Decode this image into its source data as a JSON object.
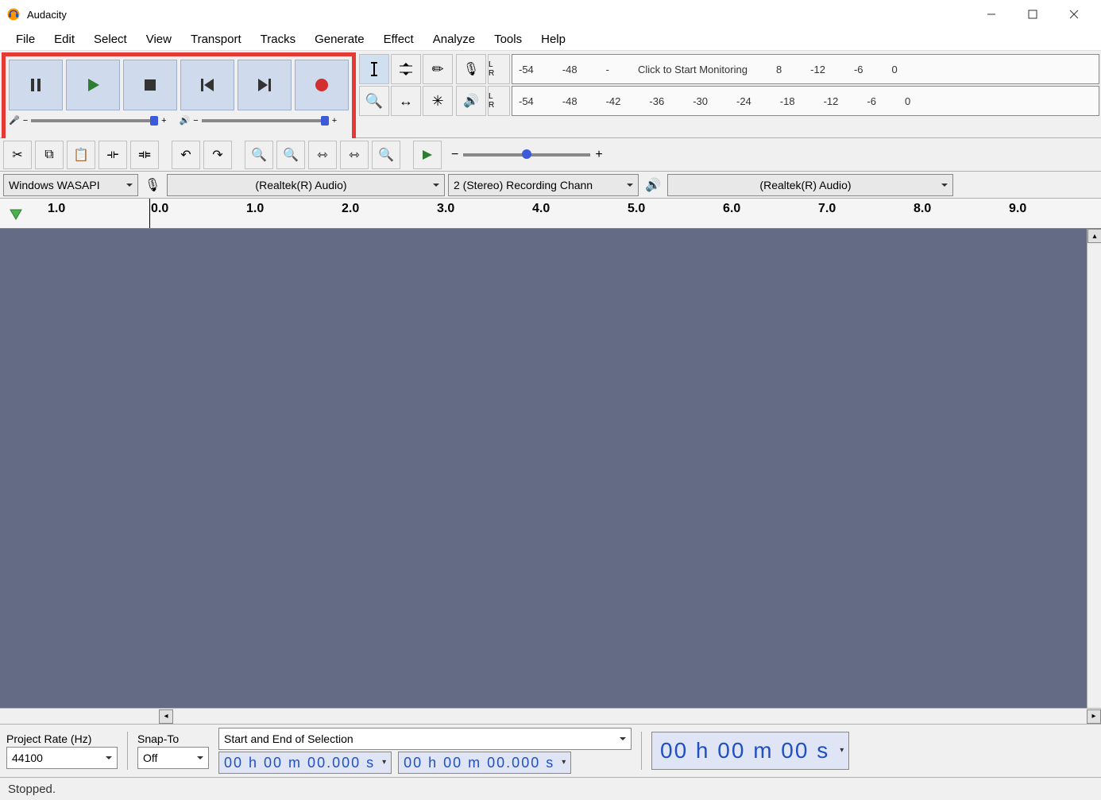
{
  "titlebar": {
    "title": "Audacity"
  },
  "menu": {
    "items": [
      "File",
      "Edit",
      "Select",
      "View",
      "Transport",
      "Tracks",
      "Generate",
      "Effect",
      "Analyze",
      "Tools",
      "Help"
    ]
  },
  "meters": {
    "rec_scale": [
      "-54",
      "-48",
      "-",
      "Click to Start Monitoring",
      "8",
      "-12",
      "-6",
      "0"
    ],
    "play_scale": [
      "-54",
      "-48",
      "-42",
      "-36",
      "-30",
      "-24",
      "-18",
      "-12",
      "-6",
      "0"
    ]
  },
  "devices": {
    "host": "Windows WASAPI",
    "rec_device": "(Realtek(R) Audio)",
    "rec_channels": "2 (Stereo) Recording Chann",
    "play_device": "(Realtek(R) Audio)"
  },
  "timeline": {
    "marks": [
      "1.0",
      "0.0",
      "1.0",
      "2.0",
      "3.0",
      "4.0",
      "5.0",
      "6.0",
      "7.0",
      "8.0",
      "9.0"
    ],
    "neg_first": "1.0"
  },
  "selection": {
    "project_rate_label": "Project Rate (Hz)",
    "project_rate": "44100",
    "snap_label": "Snap-To",
    "snap": "Off",
    "mode": "Start and End of Selection",
    "start": "00 h 00 m 00.000 s",
    "end": "00 h 00 m 00.000 s",
    "position": "00 h 00 m 00 s"
  },
  "status": {
    "text": "Stopped."
  }
}
